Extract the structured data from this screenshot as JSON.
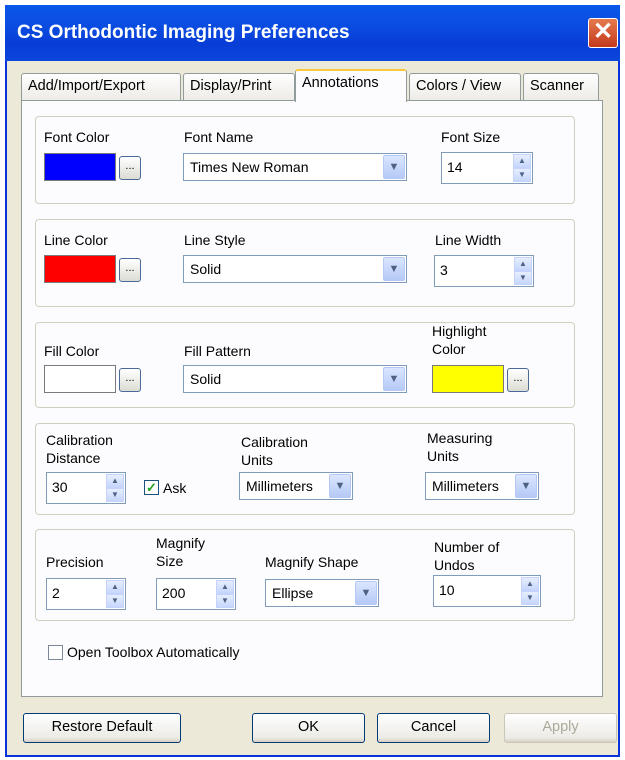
{
  "window": {
    "title": "CS Orthodontic Imaging Preferences",
    "close_glyph": "✕"
  },
  "tabs": [
    {
      "label": "Add/Import/Export"
    },
    {
      "label": "Display/Print"
    },
    {
      "label": "Annotations",
      "active": true
    },
    {
      "label": "Colors / View"
    },
    {
      "label": "Scanner"
    }
  ],
  "font": {
    "color_label": "Font Color",
    "color": "#0000ff",
    "name_label": "Font Name",
    "name_value": "Times New Roman",
    "size_label": "Font Size",
    "size_value": "14"
  },
  "line": {
    "color_label": "Line Color",
    "color": "#ff0000",
    "style_label": "Line Style",
    "style_value": "Solid",
    "width_label": "Line Width",
    "width_value": "3"
  },
  "fill": {
    "color_label": "Fill Color",
    "color": "#ffffff",
    "pattern_label": "Fill Pattern",
    "pattern_value": "Solid",
    "highlight_label_1": "Highlight",
    "highlight_label_2": "Color",
    "highlight_color": "#ffff00"
  },
  "calibration": {
    "distance_label_1": "Calibration",
    "distance_label_2": "Distance",
    "distance_value": "30",
    "ask_label": "Ask",
    "ask_checked": true,
    "units_label_1": "Calibration",
    "units_label_2": "Units",
    "units_value": "Millimeters",
    "measuring_label_1": "Measuring",
    "measuring_label_2": "Units",
    "measuring_value": "Millimeters"
  },
  "misc": {
    "precision_label": "Precision",
    "precision_value": "2",
    "magnify_size_label_1": "Magnify",
    "magnify_size_label_2": "Size",
    "magnify_size_value": "200",
    "magnify_shape_label": "Magnify Shape",
    "magnify_shape_value": "Ellipse",
    "undos_label_1": "Number of",
    "undos_label_2": "Undos",
    "undos_value": "10"
  },
  "open_toolbox": {
    "label": "Open Toolbox Automatically",
    "checked": false
  },
  "buttons": {
    "restore": "Restore Default",
    "ok": "OK",
    "cancel": "Cancel",
    "apply": "Apply"
  },
  "glyphs": {
    "dots": "...",
    "dropdown": "▼",
    "up": "▲",
    "down": "▼",
    "check": "✓"
  }
}
